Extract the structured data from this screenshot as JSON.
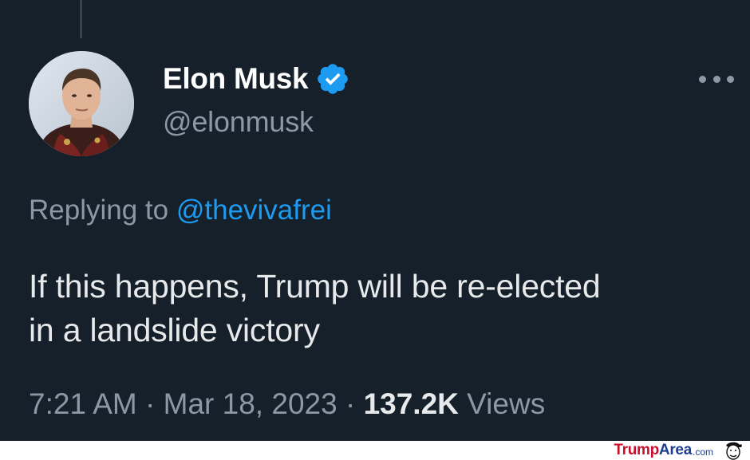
{
  "tweet": {
    "author": {
      "display_name": "Elon Musk",
      "handle": "@elonmusk",
      "verified_icon": "verified-badge-icon"
    },
    "reply": {
      "prefix": "Replying to",
      "mention": "@thevivafrei"
    },
    "text_lines": [
      "If this happens, Trump will be re-elected",
      "in a landslide victory"
    ],
    "meta": {
      "time": "7:21 AM",
      "separator": "·",
      "date": "Mar 18, 2023",
      "views_count": "137.2K",
      "views_label": "Views"
    },
    "more_icon": "more-dots-icon"
  },
  "watermark": {
    "part1": "Trump",
    "part2": "Area",
    "suffix": ".com"
  },
  "colors": {
    "background": "#15202b",
    "text_primary": "#e7e9ea",
    "text_secondary": "#8b98a5",
    "accent_blue": "#1d9bf0",
    "watermark_red": "#c8102e",
    "watermark_blue": "#1f3d8f"
  }
}
